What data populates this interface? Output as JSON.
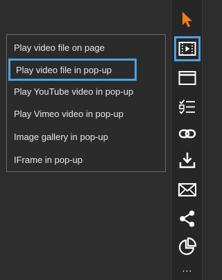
{
  "menu": {
    "items": [
      {
        "label": "Play video file on page"
      },
      {
        "label": "Play video file in pop-up",
        "selected": true
      },
      {
        "label": "Play YouTube video in pop-up"
      },
      {
        "label": "Play Vimeo video in pop-up"
      },
      {
        "label": "Image gallery in pop-up"
      },
      {
        "label": "IFrame in pop-up"
      }
    ]
  },
  "toolbar": {
    "tools": [
      {
        "icon": "cursor-arrow-icon"
      },
      {
        "icon": "video-player-icon",
        "active": true
      },
      {
        "icon": "browser-window-icon"
      },
      {
        "icon": "checklist-icon"
      },
      {
        "icon": "link-icon"
      },
      {
        "icon": "download-icon"
      },
      {
        "icon": "envelope-icon"
      },
      {
        "icon": "share-icon"
      },
      {
        "icon": "pie-chart-icon"
      }
    ],
    "more_label": "..."
  },
  "colors": {
    "background": "#2d2d2d",
    "highlight": "#4aa3e0",
    "cursor_accent": "#f07d1a",
    "icon": "#ffffff"
  }
}
